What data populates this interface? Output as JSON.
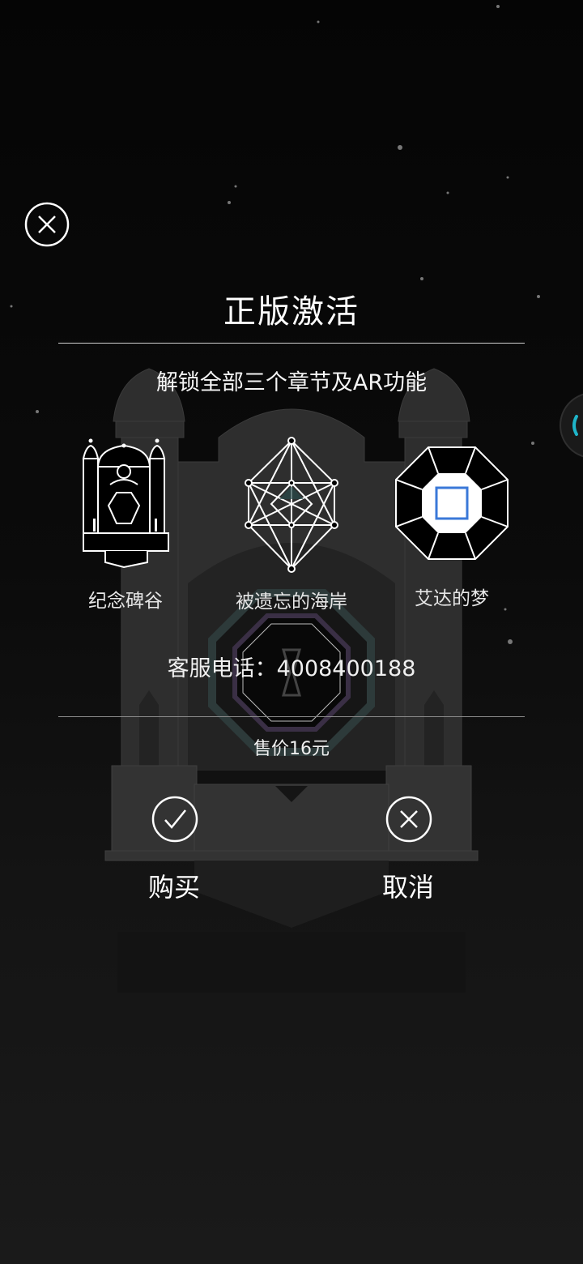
{
  "dialog": {
    "title": "正版激活",
    "subtitle": "解锁全部三个章节及AR功能",
    "chapters": [
      {
        "label": "纪念碑谷"
      },
      {
        "label": "被遗忘的海岸"
      },
      {
        "label": "艾达的梦"
      }
    ],
    "phone_text": "客服电话：4008400188",
    "price_text": "售价16元",
    "buy_label": "购买",
    "cancel_label": "取消"
  },
  "icons": {
    "close": "close-circle-icon",
    "buy": "checkmark-circle-icon",
    "cancel": "close-circle-icon"
  },
  "colors": {
    "background": "#0a0a0a",
    "text": "#ffffff",
    "accent_blue": "#3a78d8",
    "accent_cyan": "#1fb5c9"
  }
}
